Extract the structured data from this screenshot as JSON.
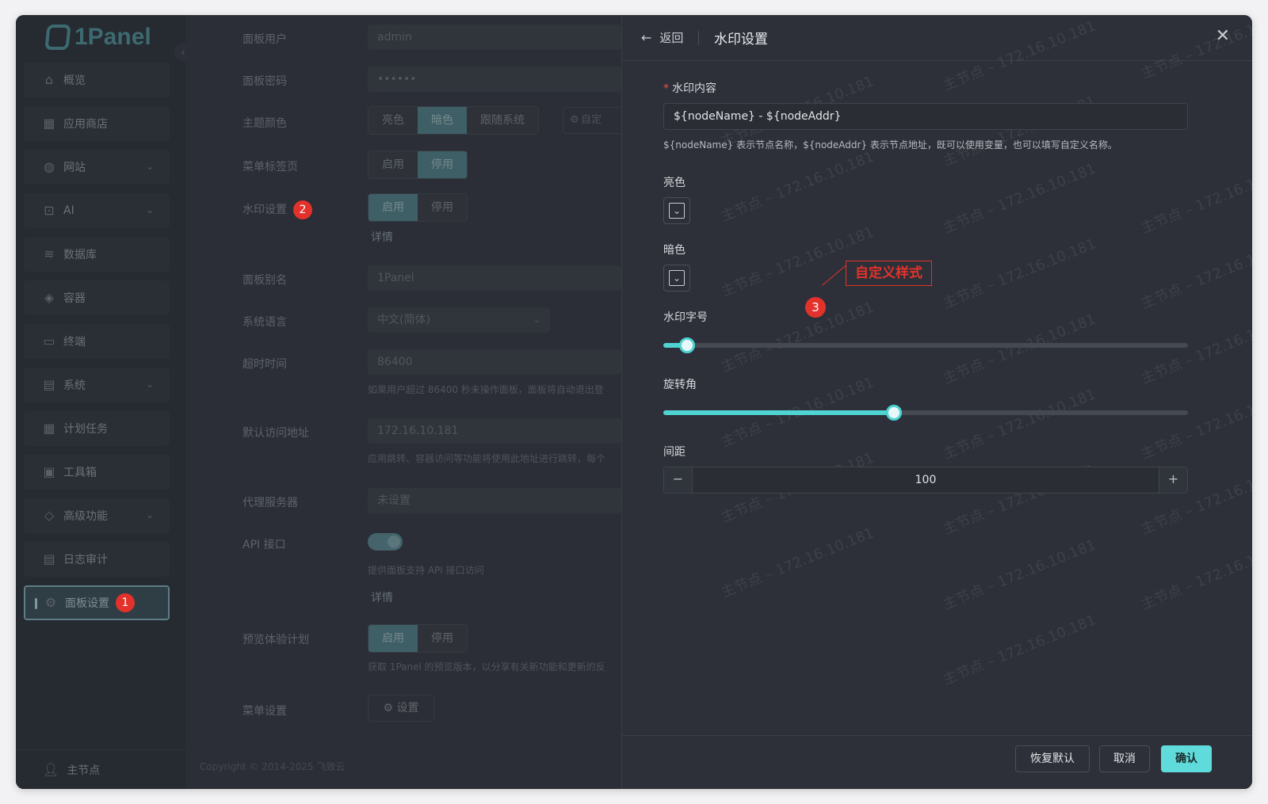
{
  "app": {
    "logo_text": "1Panel"
  },
  "sidebar": {
    "items": [
      {
        "label": "概览",
        "icon": "home-icon"
      },
      {
        "label": "应用商店",
        "icon": "apps-icon"
      },
      {
        "label": "网站",
        "icon": "globe-icon",
        "has_children": true
      },
      {
        "label": "AI",
        "icon": "robot-icon",
        "has_children": true
      },
      {
        "label": "数据库",
        "icon": "database-icon"
      },
      {
        "label": "容器",
        "icon": "container-icon"
      },
      {
        "label": "终端",
        "icon": "terminal-icon"
      },
      {
        "label": "系统",
        "icon": "system-icon",
        "has_children": true
      },
      {
        "label": "计划任务",
        "icon": "calendar-icon"
      },
      {
        "label": "工具箱",
        "icon": "toolbox-icon"
      },
      {
        "label": "高级功能",
        "icon": "diamond-icon",
        "has_children": true
      },
      {
        "label": "日志审计",
        "icon": "log-icon"
      },
      {
        "label": "面板设置",
        "icon": "gear-icon",
        "active": true,
        "badge": "1"
      }
    ],
    "node_label": "主节点"
  },
  "settings": {
    "panel_user": {
      "label": "面板用户",
      "value": "admin"
    },
    "panel_password": {
      "label": "面板密码",
      "value": "••••••"
    },
    "theme": {
      "label": "主题颜色",
      "options": [
        "亮色",
        "暗色",
        "跟随系统"
      ],
      "selected": "暗色",
      "custom_label": "自定"
    },
    "menu_tabs": {
      "label": "菜单标签页",
      "options": [
        "启用",
        "停用"
      ],
      "selected": "停用"
    },
    "watermark": {
      "label": "水印设置",
      "badge": "2",
      "options": [
        "启用",
        "停用"
      ],
      "selected": "启用",
      "detail_link": "详情"
    },
    "panel_alias": {
      "label": "面板别名",
      "value": "1Panel"
    },
    "language": {
      "label": "系统语言",
      "value": "中文(简体)"
    },
    "timeout": {
      "label": "超时时间",
      "value": "86400",
      "hint": "如果用户超过 86400 秒未操作面板，面板将自动退出登"
    },
    "default_addr": {
      "label": "默认访问地址",
      "value": "172.16.10.181",
      "hint": "应用跳转、容器访问等功能将使用此地址进行跳转，每个"
    },
    "proxy": {
      "label": "代理服务器",
      "value": "未设置"
    },
    "api": {
      "label": "API 接口",
      "hint": "提供面板支持 API 接口访问",
      "detail_link": "详情"
    },
    "preview": {
      "label": "预览体验计划",
      "options": [
        "启用",
        "停用"
      ],
      "selected": "启用",
      "hint": "获取 1Panel 的预览版本，以分享有关新功能和更新的反"
    },
    "menu_settings": {
      "label": "菜单设置",
      "button": "设置"
    },
    "copyright": "Copyright © 2014-2025 飞致云"
  },
  "drawer": {
    "back_label": "返回",
    "title": "水印设置",
    "content_label": "水印内容",
    "content_value": "${nodeName} - ${nodeAddr}",
    "content_hint": "${nodeName} 表示节点名称，${nodeAddr} 表示节点地址，既可以使用变量，也可以填写自定义名称。",
    "light_label": "亮色",
    "dark_label": "暗色",
    "font_size_label": "水印字号",
    "font_size_fraction": 0.045,
    "rotate_label": "旋转角",
    "rotate_fraction": 0.44,
    "gap_label": "间距",
    "gap_value": "100",
    "gap_minus": "−",
    "gap_plus": "+",
    "reset_button": "恢复默认",
    "cancel_button": "取消",
    "confirm_button": "确认"
  },
  "watermark_text": "主节点 – 172.16.10.181",
  "annotation": {
    "label": "自定义样式",
    "badge": "3"
  },
  "colors": {
    "accent": "#5fdbdb",
    "annotation": "#e3322b",
    "background": "#2c2f38"
  }
}
